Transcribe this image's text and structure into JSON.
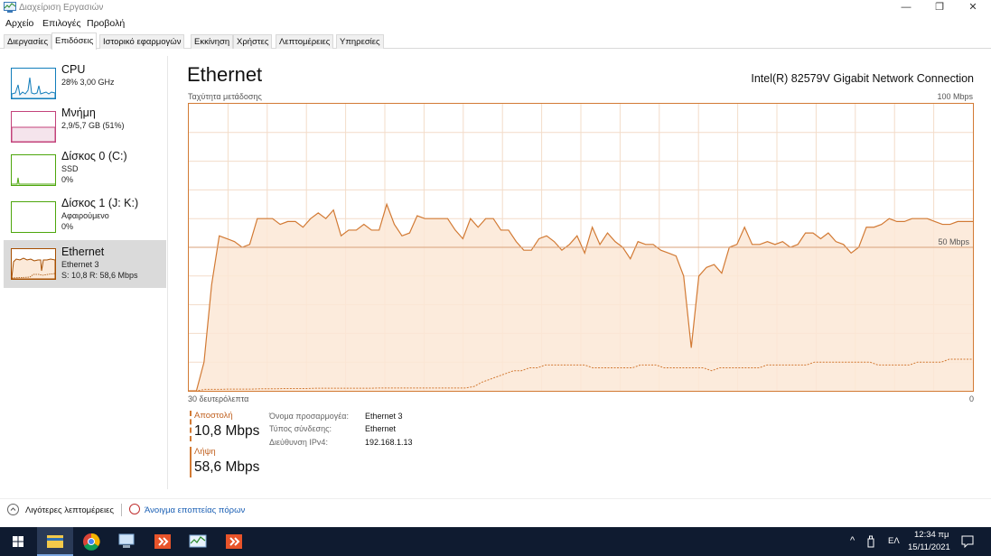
{
  "window": {
    "title": "Διαχείριση Εργασιών",
    "minimize_glyph": "—",
    "restore_glyph": "❐",
    "close_glyph": "✕"
  },
  "menu": [
    "Αρχείο",
    "Επιλογές",
    "Προβολή"
  ],
  "tabs": [
    "Διεργασίες",
    "Επιδόσεις",
    "Ιστορικό εφαρμογών",
    "Εκκίνηση",
    "Χρήστες",
    "Λεπτομέρειες",
    "Υπηρεσίες"
  ],
  "active_tab": "Επιδόσεις",
  "sidebar": {
    "items": [
      {
        "name": "CPU",
        "line1": "28% 3,00 GHz",
        "line2": "",
        "color": "#117dbb"
      },
      {
        "name": "Μνήμη",
        "line1": "2,9/5,7 GB (51%)",
        "line2": "",
        "color": "#8b125d"
      },
      {
        "name": "Δίσκος 0 (C:)",
        "line1": "SSD",
        "line2": "0%",
        "color": "#4da60c"
      },
      {
        "name": "Δίσκος 1 (J: K:)",
        "line1": "Αφαιρούμενο",
        "line2": "0%",
        "color": "#4da60c"
      },
      {
        "name": "Ethernet",
        "line1": "Ethernet 3",
        "line2": "S: 10,8  R: 58,6 Mbps",
        "color": "#a74f01"
      }
    ],
    "selected": "Ethernet"
  },
  "main": {
    "title": "Ethernet",
    "adapter": "Intel(R) 82579V Gigabit Network Connection",
    "graph_label": "Ταχύτητα μετάδοσης",
    "graph_max": "100 Mbps",
    "graph_mid": "50 Mbps",
    "time_label": "30 δευτερόλεπτα",
    "graph_zero": "0",
    "send": {
      "label": "Αποστολή",
      "value": "10,8 Mbps"
    },
    "receive": {
      "label": "Λήψη",
      "value": "58,6 Mbps"
    },
    "info": [
      {
        "key": "Όνομα προσαρμογέα:",
        "value": "Ethernet 3"
      },
      {
        "key": "Τύπος σύνδεσης:",
        "value": "Ethernet"
      },
      {
        "key": "Διεύθυνση IPv4:",
        "value": "192.168.1.13"
      }
    ]
  },
  "chart_data": {
    "type": "area",
    "ylim": [
      0,
      100
    ],
    "y_unit": "Mbps",
    "series": [
      {
        "values": [
          0,
          0,
          10,
          37,
          54,
          53,
          52,
          50,
          51,
          60,
          60,
          60,
          58,
          59,
          59,
          57,
          60,
          62,
          60,
          63,
          54,
          56,
          56,
          58,
          56,
          56,
          65,
          58,
          54,
          55,
          61,
          60,
          60,
          60,
          60,
          56,
          53,
          60,
          57,
          60,
          60,
          56,
          56,
          52,
          49,
          49,
          53,
          54,
          52,
          49,
          51,
          54,
          48,
          57,
          51,
          55,
          52,
          50,
          46,
          52,
          51,
          51,
          49,
          48,
          47,
          40,
          15,
          40,
          43,
          44,
          41,
          50,
          51,
          57,
          51,
          51,
          52,
          51,
          52,
          50,
          51,
          55,
          55,
          53,
          55,
          52,
          51,
          48,
          50,
          57,
          57,
          58,
          60,
          59,
          59,
          60,
          60,
          60,
          59,
          58,
          58,
          59,
          59,
          59
        ]
      },
      {
        "values": [
          0,
          0,
          0.5,
          0.5,
          0.5,
          0.6,
          0.6,
          0.6,
          0.6,
          0.7,
          0.7,
          0.7,
          0.8,
          0.8,
          0.8,
          0.8,
          0.9,
          0.9,
          0.9,
          0.9,
          0.9,
          0.9,
          0.9,
          0.9,
          1,
          1,
          1,
          1,
          1,
          1,
          1,
          1,
          1,
          1,
          1,
          1,
          1.5,
          3,
          4,
          5,
          6,
          7,
          7,
          8,
          8,
          9,
          9,
          9,
          9,
          9,
          9,
          8,
          8,
          8,
          8,
          8,
          8,
          9,
          9,
          9,
          8,
          8,
          8,
          8,
          8,
          8,
          7,
          8,
          8,
          8,
          8,
          8,
          8,
          9,
          9,
          9,
          9,
          9,
          9,
          10,
          10,
          10,
          10,
          10,
          10,
          10,
          10,
          9,
          9,
          9,
          9,
          9,
          10,
          10,
          10,
          10,
          11,
          11,
          11,
          11
        ]
      }
    ]
  }
}
